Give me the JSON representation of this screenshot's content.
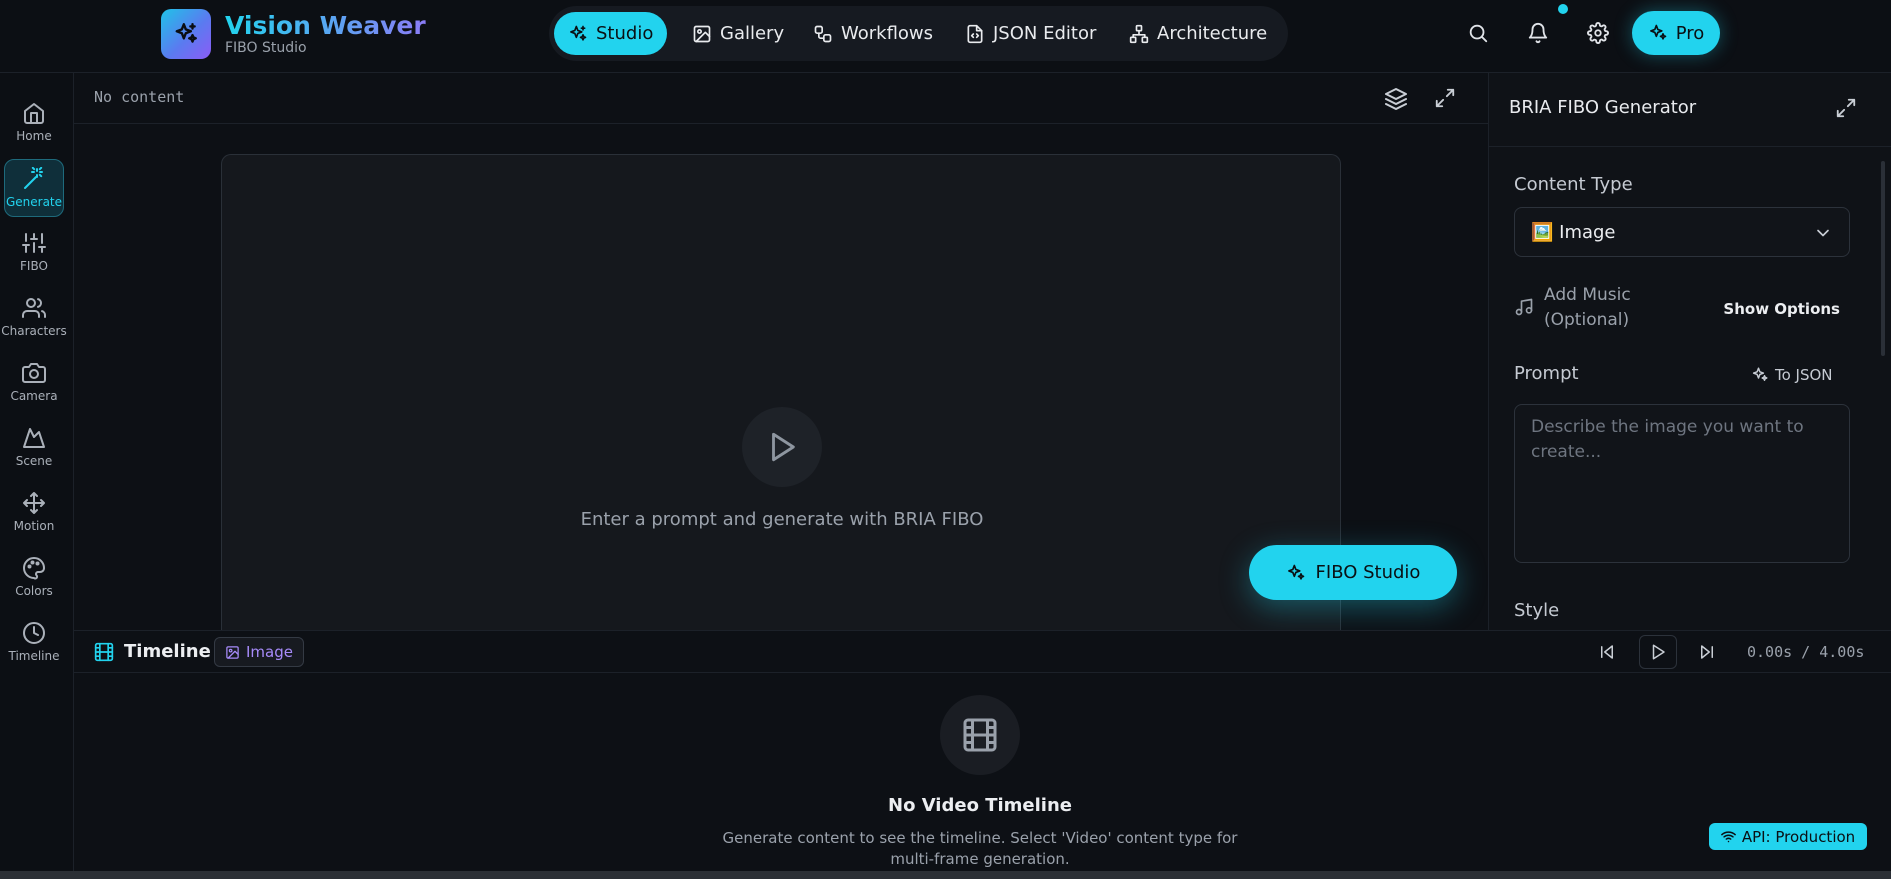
{
  "brand": {
    "title": "Vision Weaver",
    "subtitle": "FIBO Studio",
    "icon": "sparkles-icon",
    "gradient": [
      "#22d3ee",
      "#8b5cf6"
    ]
  },
  "nav": {
    "items": [
      {
        "label": "Studio",
        "icon": "sparkles-icon",
        "active": true
      },
      {
        "label": "Gallery",
        "icon": "image-icon",
        "active": false
      },
      {
        "label": "Workflows",
        "icon": "workflow-icon",
        "active": false
      },
      {
        "label": "JSON Editor",
        "icon": "file-code-icon",
        "active": false
      },
      {
        "label": "Architecture",
        "icon": "network-icon",
        "active": false
      }
    ]
  },
  "top_actions": {
    "search_icon": "search-icon",
    "bell_icon": "bell-icon",
    "settings_icon": "gear-icon",
    "pro_label": "Pro"
  },
  "sidebar": {
    "items": [
      {
        "label": "Home",
        "icon": "home-icon",
        "active": false
      },
      {
        "label": "Generate",
        "icon": "wand-icon",
        "active": true
      },
      {
        "label": "FIBO",
        "icon": "sliders-icon",
        "active": false
      },
      {
        "label": "Characters",
        "icon": "users-icon",
        "active": false
      },
      {
        "label": "Camera",
        "icon": "camera-icon",
        "active": false
      },
      {
        "label": "Scene",
        "icon": "mountain-icon",
        "active": false
      },
      {
        "label": "Motion",
        "icon": "move-icon",
        "active": false
      },
      {
        "label": "Colors",
        "icon": "palette-icon",
        "active": false
      },
      {
        "label": "Timeline",
        "icon": "clock-icon",
        "active": false
      }
    ]
  },
  "canvas": {
    "status": "No content",
    "hint": "Enter a prompt and generate with BRIA FIBO",
    "studio_button": "FIBO Studio"
  },
  "panel": {
    "title": "BRIA FIBO Generator",
    "content_type_label": "Content Type",
    "content_type_value": "🖼️ Image",
    "music_label": "Add Music (Optional)",
    "show_options": "Show Options",
    "prompt_label": "Prompt",
    "to_json": "To JSON",
    "prompt_placeholder": "Describe the image you want to create...",
    "style_label": "Style"
  },
  "timeline": {
    "title": "Timeline",
    "badge": "Image",
    "time": "0.00s / 4.00s",
    "empty_title": "No Video Timeline",
    "empty_text": "Generate content to see the timeline. Select 'Video' content type for multi-frame generation."
  },
  "api_status": "API: Production",
  "colors": {
    "accent": "#22d3ee",
    "badge_purple": "#a78bfa",
    "background": "#0d1015"
  }
}
